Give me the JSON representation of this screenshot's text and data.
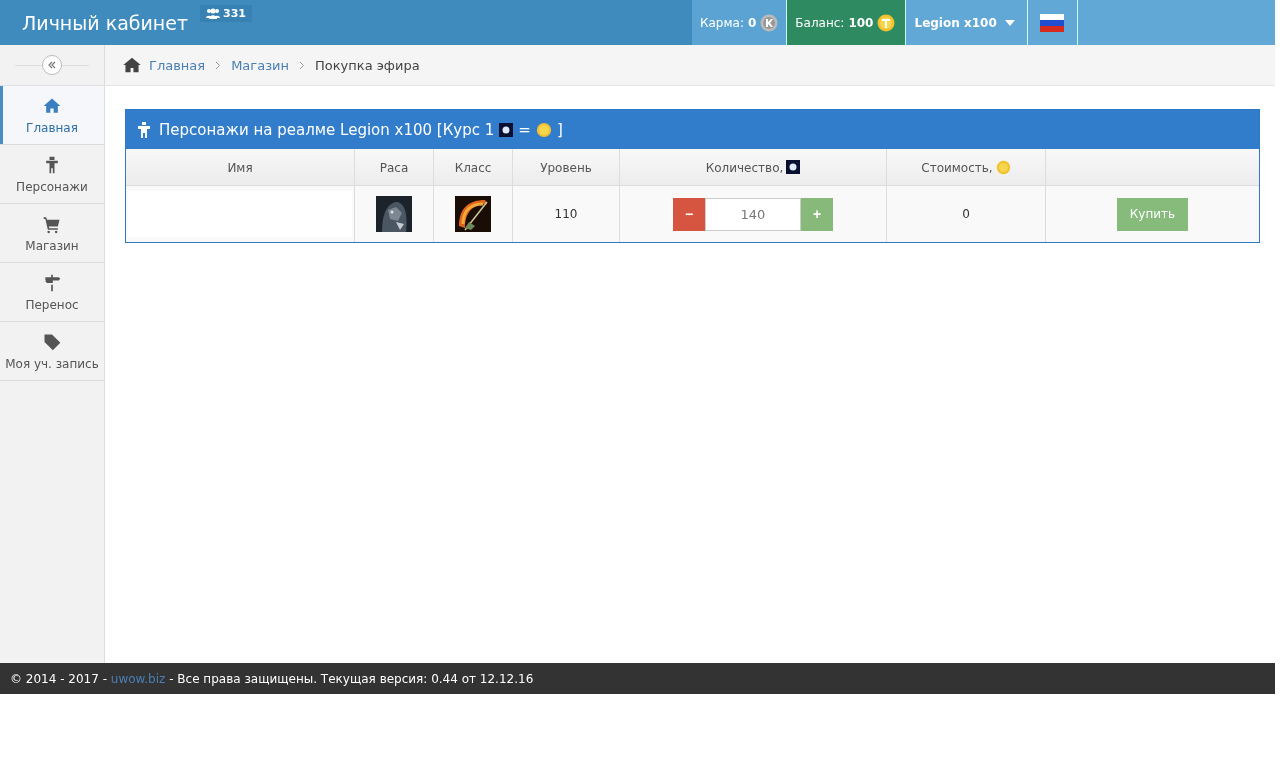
{
  "header": {
    "title": "Личный кабинет",
    "online_count": "331",
    "karma_label": "Карма:",
    "karma_value": "0",
    "balance_label": "Баланс:",
    "balance_value": "100",
    "realm": "Legion x100"
  },
  "sidebar": {
    "items": [
      {
        "label": "Главная",
        "selected": true
      },
      {
        "label": "Персонажи",
        "selected": false
      },
      {
        "label": "Магазин",
        "selected": false
      },
      {
        "label": "Перенос",
        "selected": false
      },
      {
        "label": "Моя уч. запись",
        "selected": false
      }
    ]
  },
  "breadcrumbs": [
    {
      "label": "Главная",
      "link": true
    },
    {
      "label": "Магазин",
      "link": true
    },
    {
      "label": "Покупка эфира",
      "link": false
    }
  ],
  "panel": {
    "title": "Персонажи на реалме Legion x100 [Курс 1",
    "title_eq": "=",
    "title_end": "]",
    "columns": [
      "Имя",
      "Раса",
      "Класс",
      "Уровень",
      "Количество,",
      "Стоимость,"
    ],
    "rows": [
      {
        "level": "110",
        "quantity": "140",
        "cost": "0",
        "minus": "−",
        "plus": "+",
        "buy": "Купить"
      }
    ]
  },
  "footer": {
    "prefix": "© 2014 - 2017 -",
    "link": "uwow.biz",
    "suffix": "- Все права защищены. Текущая версия: 0.44 от 12.12.16"
  }
}
